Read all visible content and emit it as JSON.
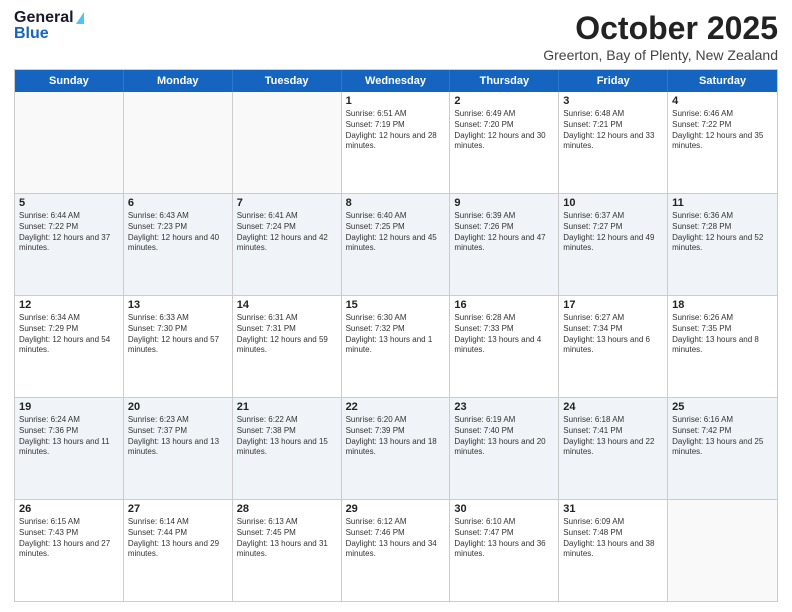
{
  "logo": {
    "general": "General",
    "blue": "Blue"
  },
  "header": {
    "month": "October 2025",
    "location": "Greerton, Bay of Plenty, New Zealand"
  },
  "dayHeaders": [
    "Sunday",
    "Monday",
    "Tuesday",
    "Wednesday",
    "Thursday",
    "Friday",
    "Saturday"
  ],
  "weeks": [
    [
      {
        "date": "",
        "sunrise": "",
        "sunset": "",
        "daylight": ""
      },
      {
        "date": "",
        "sunrise": "",
        "sunset": "",
        "daylight": ""
      },
      {
        "date": "",
        "sunrise": "",
        "sunset": "",
        "daylight": ""
      },
      {
        "date": "1",
        "sunrise": "Sunrise: 6:51 AM",
        "sunset": "Sunset: 7:19 PM",
        "daylight": "Daylight: 12 hours and 28 minutes."
      },
      {
        "date": "2",
        "sunrise": "Sunrise: 6:49 AM",
        "sunset": "Sunset: 7:20 PM",
        "daylight": "Daylight: 12 hours and 30 minutes."
      },
      {
        "date": "3",
        "sunrise": "Sunrise: 6:48 AM",
        "sunset": "Sunset: 7:21 PM",
        "daylight": "Daylight: 12 hours and 33 minutes."
      },
      {
        "date": "4",
        "sunrise": "Sunrise: 6:46 AM",
        "sunset": "Sunset: 7:22 PM",
        "daylight": "Daylight: 12 hours and 35 minutes."
      }
    ],
    [
      {
        "date": "5",
        "sunrise": "Sunrise: 6:44 AM",
        "sunset": "Sunset: 7:22 PM",
        "daylight": "Daylight: 12 hours and 37 minutes."
      },
      {
        "date": "6",
        "sunrise": "Sunrise: 6:43 AM",
        "sunset": "Sunset: 7:23 PM",
        "daylight": "Daylight: 12 hours and 40 minutes."
      },
      {
        "date": "7",
        "sunrise": "Sunrise: 6:41 AM",
        "sunset": "Sunset: 7:24 PM",
        "daylight": "Daylight: 12 hours and 42 minutes."
      },
      {
        "date": "8",
        "sunrise": "Sunrise: 6:40 AM",
        "sunset": "Sunset: 7:25 PM",
        "daylight": "Daylight: 12 hours and 45 minutes."
      },
      {
        "date": "9",
        "sunrise": "Sunrise: 6:39 AM",
        "sunset": "Sunset: 7:26 PM",
        "daylight": "Daylight: 12 hours and 47 minutes."
      },
      {
        "date": "10",
        "sunrise": "Sunrise: 6:37 AM",
        "sunset": "Sunset: 7:27 PM",
        "daylight": "Daylight: 12 hours and 49 minutes."
      },
      {
        "date": "11",
        "sunrise": "Sunrise: 6:36 AM",
        "sunset": "Sunset: 7:28 PM",
        "daylight": "Daylight: 12 hours and 52 minutes."
      }
    ],
    [
      {
        "date": "12",
        "sunrise": "Sunrise: 6:34 AM",
        "sunset": "Sunset: 7:29 PM",
        "daylight": "Daylight: 12 hours and 54 minutes."
      },
      {
        "date": "13",
        "sunrise": "Sunrise: 6:33 AM",
        "sunset": "Sunset: 7:30 PM",
        "daylight": "Daylight: 12 hours and 57 minutes."
      },
      {
        "date": "14",
        "sunrise": "Sunrise: 6:31 AM",
        "sunset": "Sunset: 7:31 PM",
        "daylight": "Daylight: 12 hours and 59 minutes."
      },
      {
        "date": "15",
        "sunrise": "Sunrise: 6:30 AM",
        "sunset": "Sunset: 7:32 PM",
        "daylight": "Daylight: 13 hours and 1 minute."
      },
      {
        "date": "16",
        "sunrise": "Sunrise: 6:28 AM",
        "sunset": "Sunset: 7:33 PM",
        "daylight": "Daylight: 13 hours and 4 minutes."
      },
      {
        "date": "17",
        "sunrise": "Sunrise: 6:27 AM",
        "sunset": "Sunset: 7:34 PM",
        "daylight": "Daylight: 13 hours and 6 minutes."
      },
      {
        "date": "18",
        "sunrise": "Sunrise: 6:26 AM",
        "sunset": "Sunset: 7:35 PM",
        "daylight": "Daylight: 13 hours and 8 minutes."
      }
    ],
    [
      {
        "date": "19",
        "sunrise": "Sunrise: 6:24 AM",
        "sunset": "Sunset: 7:36 PM",
        "daylight": "Daylight: 13 hours and 11 minutes."
      },
      {
        "date": "20",
        "sunrise": "Sunrise: 6:23 AM",
        "sunset": "Sunset: 7:37 PM",
        "daylight": "Daylight: 13 hours and 13 minutes."
      },
      {
        "date": "21",
        "sunrise": "Sunrise: 6:22 AM",
        "sunset": "Sunset: 7:38 PM",
        "daylight": "Daylight: 13 hours and 15 minutes."
      },
      {
        "date": "22",
        "sunrise": "Sunrise: 6:20 AM",
        "sunset": "Sunset: 7:39 PM",
        "daylight": "Daylight: 13 hours and 18 minutes."
      },
      {
        "date": "23",
        "sunrise": "Sunrise: 6:19 AM",
        "sunset": "Sunset: 7:40 PM",
        "daylight": "Daylight: 13 hours and 20 minutes."
      },
      {
        "date": "24",
        "sunrise": "Sunrise: 6:18 AM",
        "sunset": "Sunset: 7:41 PM",
        "daylight": "Daylight: 13 hours and 22 minutes."
      },
      {
        "date": "25",
        "sunrise": "Sunrise: 6:16 AM",
        "sunset": "Sunset: 7:42 PM",
        "daylight": "Daylight: 13 hours and 25 minutes."
      }
    ],
    [
      {
        "date": "26",
        "sunrise": "Sunrise: 6:15 AM",
        "sunset": "Sunset: 7:43 PM",
        "daylight": "Daylight: 13 hours and 27 minutes."
      },
      {
        "date": "27",
        "sunrise": "Sunrise: 6:14 AM",
        "sunset": "Sunset: 7:44 PM",
        "daylight": "Daylight: 13 hours and 29 minutes."
      },
      {
        "date": "28",
        "sunrise": "Sunrise: 6:13 AM",
        "sunset": "Sunset: 7:45 PM",
        "daylight": "Daylight: 13 hours and 31 minutes."
      },
      {
        "date": "29",
        "sunrise": "Sunrise: 6:12 AM",
        "sunset": "Sunset: 7:46 PM",
        "daylight": "Daylight: 13 hours and 34 minutes."
      },
      {
        "date": "30",
        "sunrise": "Sunrise: 6:10 AM",
        "sunset": "Sunset: 7:47 PM",
        "daylight": "Daylight: 13 hours and 36 minutes."
      },
      {
        "date": "31",
        "sunrise": "Sunrise: 6:09 AM",
        "sunset": "Sunset: 7:48 PM",
        "daylight": "Daylight: 13 hours and 38 minutes."
      },
      {
        "date": "",
        "sunrise": "",
        "sunset": "",
        "daylight": ""
      }
    ]
  ]
}
